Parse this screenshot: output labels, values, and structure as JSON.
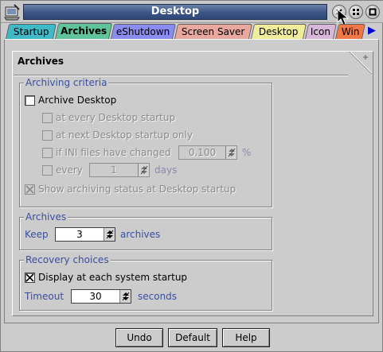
{
  "window": {
    "title": "Desktop"
  },
  "tabs": [
    {
      "label": "Startup",
      "color": "#3fb8c8"
    },
    {
      "label": "Archives",
      "color": "#5fc49c",
      "active": true
    },
    {
      "label": "eShutdown",
      "color": "#8a8cf0"
    },
    {
      "label": "Screen Saver",
      "color": "#e8a8a0"
    },
    {
      "label": "Desktop",
      "color": "#f0ec9a"
    },
    {
      "label": "Icon",
      "color": "#d8b8d8"
    },
    {
      "label": "Win",
      "color": "#f07848"
    }
  ],
  "page": {
    "title": "Archives",
    "criteria": {
      "label": "Archiving criteria",
      "archive_desktop": {
        "label": "Archive Desktop",
        "checked": false
      },
      "every_startup": "at every Desktop startup",
      "next_startup": "at next Desktop startup only",
      "ini_changed": {
        "label": "if INI files have changed",
        "value": "0.100",
        "unit": "%"
      },
      "every": {
        "label": "every",
        "value": "1",
        "unit": "days"
      },
      "show_status": "Show archiving status at Desktop startup"
    },
    "archives": {
      "label": "Archives",
      "keep_label": "Keep",
      "keep_value": "3",
      "keep_unit": "archives"
    },
    "recovery": {
      "label": "Recovery choices",
      "display_label": "Display at each system startup",
      "timeout_label": "Timeout",
      "timeout_value": "30",
      "timeout_unit": "seconds"
    }
  },
  "buttons": {
    "undo": "Undo",
    "default": "Default",
    "help": "Help"
  }
}
